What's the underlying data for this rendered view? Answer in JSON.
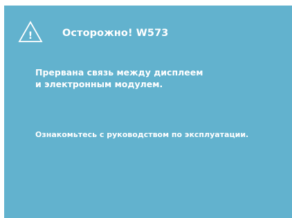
{
  "colors": {
    "panel_background": "#62b2ce",
    "text": "#ffffff"
  },
  "alert": {
    "icon": "warning-triangle-icon",
    "icon_glyph": "!",
    "title": "Осторожно! W573",
    "message_lines": [
      "Прервана связь между дисплеем",
      "и электронным модулем."
    ],
    "hint": "Ознакомьтесь с руководством по эксплуатации."
  }
}
